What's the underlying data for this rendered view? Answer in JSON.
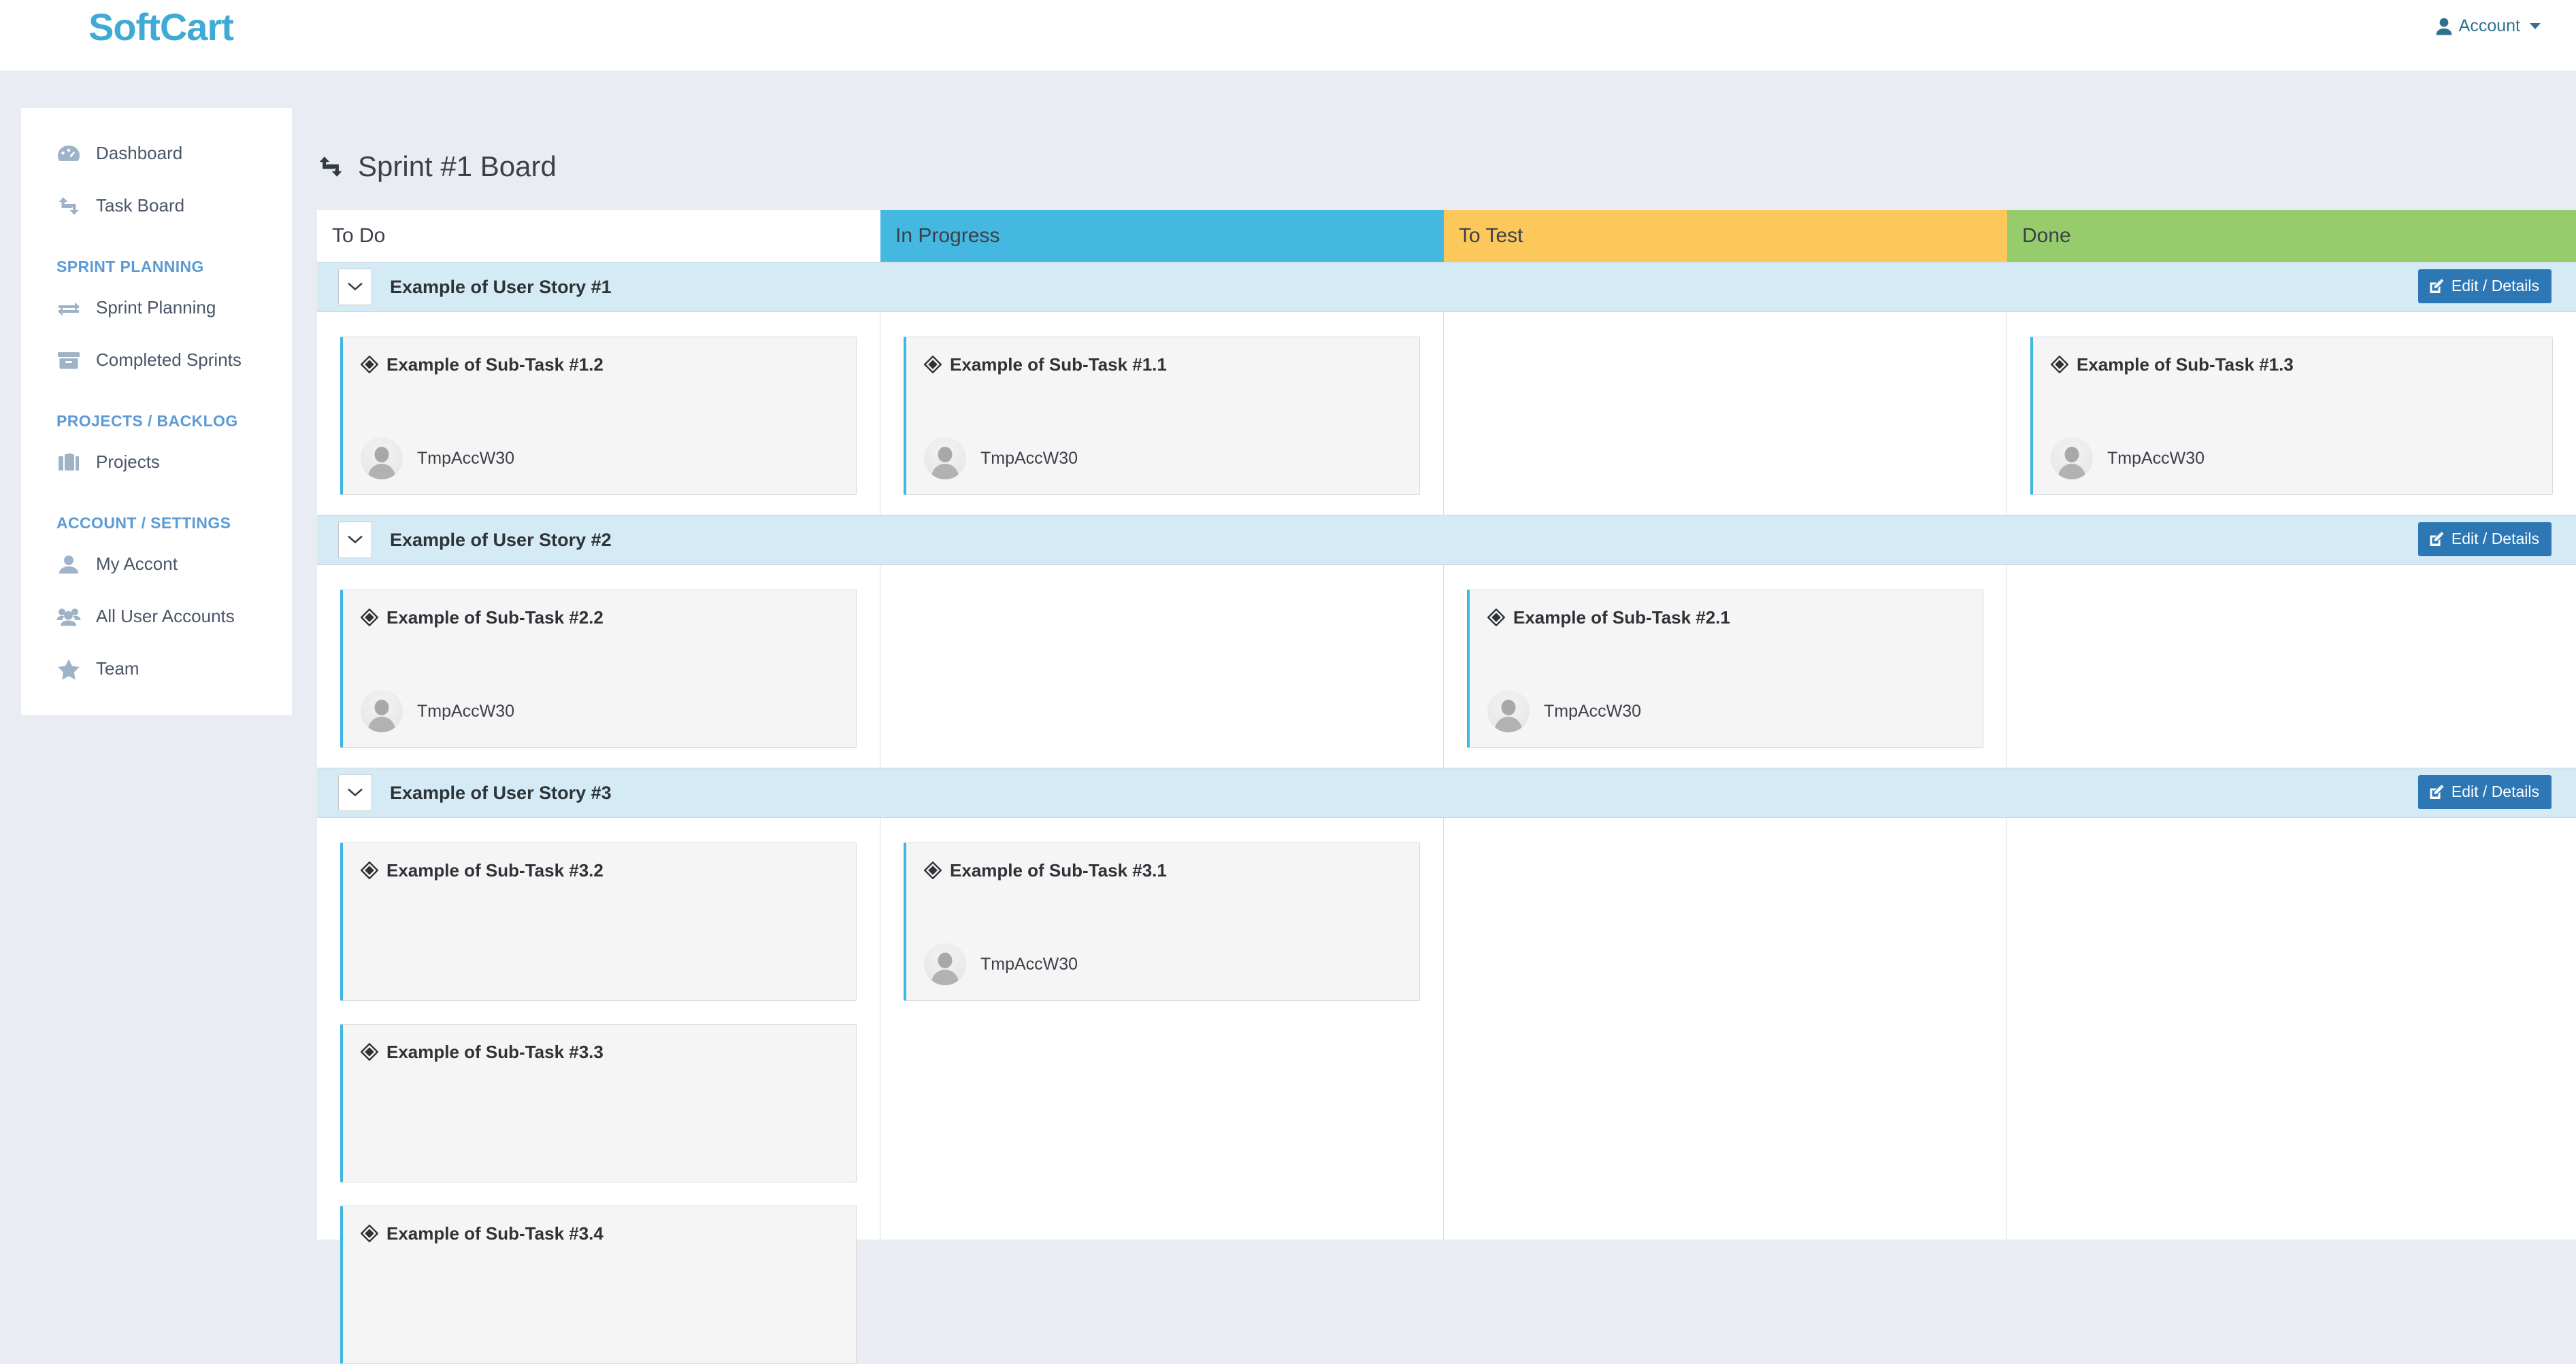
{
  "brand": "SoftCart",
  "topbar": {
    "account_label": "Account"
  },
  "sidebar": {
    "items": [
      {
        "label": "Dashboard",
        "icon": "dashboard-icon"
      },
      {
        "label": "Task Board",
        "icon": "task-board-icon"
      }
    ],
    "sections": [
      {
        "title": "SPRINT PLANNING",
        "items": [
          {
            "label": "Sprint Planning",
            "icon": "exchange-icon"
          },
          {
            "label": "Completed Sprints",
            "icon": "archive-icon"
          }
        ]
      },
      {
        "title": "PROJECTS / BACKLOG",
        "items": [
          {
            "label": "Projects",
            "icon": "briefcase-icon"
          }
        ]
      },
      {
        "title": "ACCOUNT / SETTINGS",
        "items": [
          {
            "label": "My Accont",
            "icon": "user-icon"
          },
          {
            "label": "All User Accounts",
            "icon": "users-icon"
          },
          {
            "label": "Team",
            "icon": "star-icon"
          }
        ]
      }
    ]
  },
  "main": {
    "page_title": "Sprint #1 Board",
    "columns": [
      {
        "label": "To Do",
        "color": "#ffffff"
      },
      {
        "label": "In Progress",
        "color": "#44b8e0"
      },
      {
        "label": "To Test",
        "color": "#fcc85c"
      },
      {
        "label": "Done",
        "color": "#96cc6b"
      }
    ],
    "edit_label": "Edit / Details",
    "stories": [
      {
        "title": "Example of User Story #1",
        "cards": {
          "todo": [
            {
              "title": "Example of Sub-Task #1.2",
              "assignee": "TmpAccW30"
            }
          ],
          "prog": [
            {
              "title": "Example of Sub-Task #1.1",
              "assignee": "TmpAccW30"
            }
          ],
          "test": [],
          "done": [
            {
              "title": "Example of Sub-Task #1.3",
              "assignee": "TmpAccW30"
            }
          ]
        }
      },
      {
        "title": "Example of User Story #2",
        "cards": {
          "todo": [
            {
              "title": "Example of Sub-Task #2.2",
              "assignee": "TmpAccW30"
            }
          ],
          "prog": [],
          "test": [
            {
              "title": "Example of Sub-Task #2.1",
              "assignee": "TmpAccW30"
            }
          ],
          "done": []
        }
      },
      {
        "title": "Example of User Story #3",
        "cards": {
          "todo": [
            {
              "title": "Example of Sub-Task #3.2",
              "assignee": null
            },
            {
              "title": "Example of Sub-Task #3.3",
              "assignee": null
            },
            {
              "title": "Example of Sub-Task #3.4",
              "assignee": null
            }
          ],
          "prog": [
            {
              "title": "Example of Sub-Task #3.1",
              "assignee": "TmpAccW30"
            }
          ],
          "test": [],
          "done": []
        }
      }
    ]
  },
  "colors": {
    "brand": "#3fabd4",
    "card_accent": "#3db7e4",
    "story_band": "#d4ebf5",
    "edit_button": "#2e77b5",
    "page_bg": "#e9ecf3"
  }
}
